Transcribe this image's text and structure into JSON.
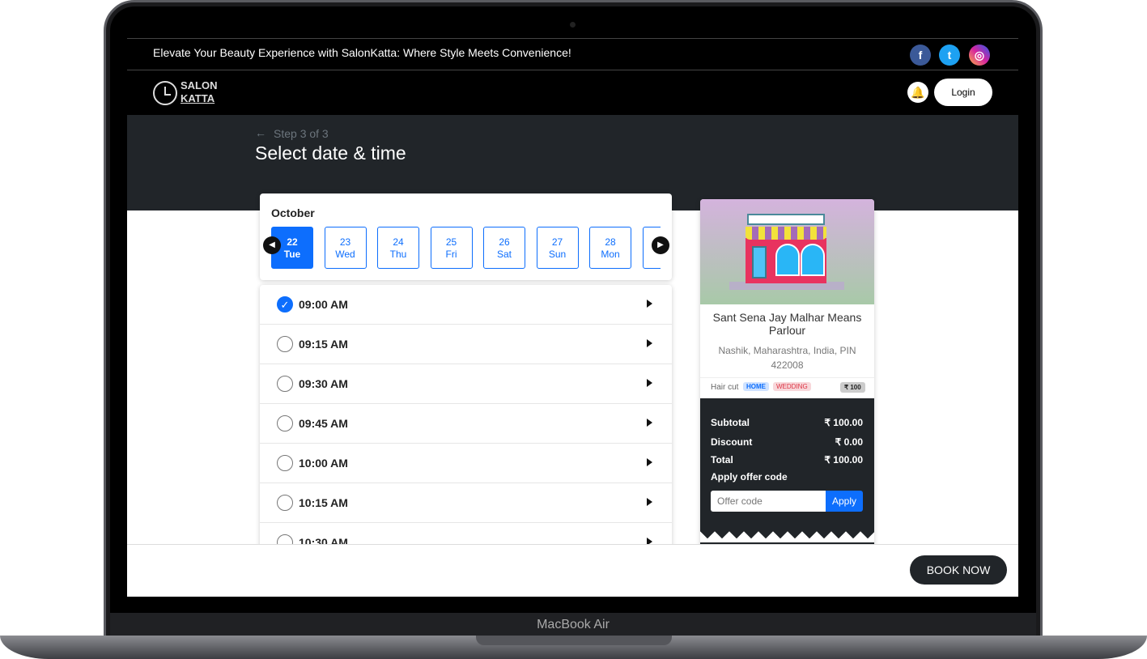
{
  "device_label": "MacBook Air",
  "topbar": {
    "tagline": "Elevate Your Beauty Experience with SalonKatta: Where Style Meets Convenience!",
    "social": [
      {
        "icon": "facebook-icon",
        "glyph": "f",
        "color": "#3b5998"
      },
      {
        "icon": "twitter-icon",
        "glyph": "t",
        "color": "#1da1f2"
      },
      {
        "icon": "instagram-icon",
        "glyph": "◎",
        "color": "#d6249f"
      }
    ]
  },
  "nav": {
    "logo_top": "SALON",
    "logo_bottom": "KATTA",
    "login": "Login"
  },
  "header": {
    "step": "Step 3 of 3",
    "title": "Select date & time"
  },
  "calendar": {
    "month": "October",
    "days": [
      {
        "d": "22",
        "w": "Tue",
        "selected": true
      },
      {
        "d": "23",
        "w": "Wed"
      },
      {
        "d": "24",
        "w": "Thu"
      },
      {
        "d": "25",
        "w": "Fri"
      },
      {
        "d": "26",
        "w": "Sat"
      },
      {
        "d": "27",
        "w": "Sun"
      },
      {
        "d": "28",
        "w": "Mon"
      }
    ]
  },
  "times": [
    {
      "t": "09:00 AM",
      "selected": true
    },
    {
      "t": "09:15 AM"
    },
    {
      "t": "09:30 AM"
    },
    {
      "t": "09:45 AM"
    },
    {
      "t": "10:00 AM"
    },
    {
      "t": "10:15 AM"
    },
    {
      "t": "10:30 AM"
    }
  ],
  "salon": {
    "name": "Sant Sena Jay Malhar Means Parlour",
    "address": "Nashik, Maharashtra, India, PIN 422008",
    "service": "Hair cut",
    "tags": [
      "HOME",
      "WEDDING"
    ],
    "price": "₹ 100"
  },
  "summary": {
    "subtotal_label": "Subtotal",
    "subtotal": "₹ 100.00",
    "discount_label": "Discount",
    "discount": "₹ 0.00",
    "total_label": "Total",
    "total": "₹ 100.00",
    "offer_label": "Apply offer code",
    "offer_placeholder": "Offer code",
    "apply": "Apply"
  },
  "footer": {
    "book": "BOOK NOW"
  },
  "colors": {
    "primary": "#0d6efd",
    "dark": "#212529"
  }
}
